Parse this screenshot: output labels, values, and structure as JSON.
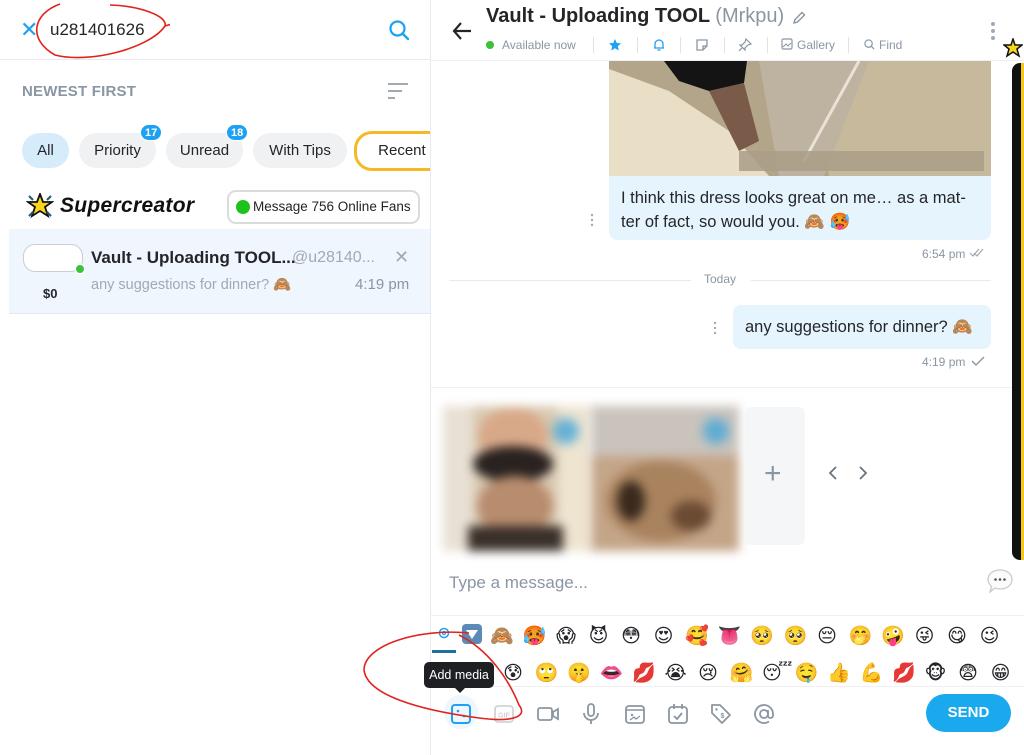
{
  "search": {
    "value": "u281401626",
    "clear_icon": "close-icon",
    "search_icon": "search-icon"
  },
  "sort": {
    "label": "NEWEST FIRST",
    "icon": "sort-icon"
  },
  "filters": [
    {
      "label": "All",
      "active": true
    },
    {
      "label": "Priority",
      "badge": "17"
    },
    {
      "label": "Unread",
      "badge": "18"
    },
    {
      "label": "With Tips"
    },
    {
      "label": "Recent B"
    }
  ],
  "supercreator": {
    "brand": "Supercreator",
    "online_button": "Message 756 Online Fans"
  },
  "chat_list": [
    {
      "name": "Vault - Uploading TOOL...",
      "handle": "@u28140...",
      "preview": "any suggestions for dinner? 🙈",
      "time": "4:19 pm",
      "amount": "$0",
      "online": true
    }
  ],
  "conversation": {
    "title": "Vault - Uploading TOOL",
    "nickname": "(Mrkpu)",
    "status": "Available now",
    "actions": {
      "gallery": "Gallery",
      "find": "Find"
    },
    "messages": [
      {
        "type": "photo",
        "text": "I think this dress looks great on me… as a mat-ter of fact, so would you. 🙈 🥵",
        "time": "6:54 pm",
        "read_status": "double-check"
      },
      {
        "type": "divider",
        "label": "Today"
      },
      {
        "type": "text",
        "text": "any suggestions for dinner? 🙈",
        "time": "4:19 pm",
        "read_status": "single-check"
      }
    ]
  },
  "composer": {
    "placeholder": "Type a message...",
    "attached_media_count": 2,
    "emoji_row_1": [
      "🙈",
      "🥵",
      "😱",
      "😈",
      "😳",
      "😍",
      "🥰",
      "👅",
      "🥺",
      "🥺",
      "😔",
      "🤭",
      "🤪",
      "😜",
      "😋",
      "😉"
    ],
    "emoji_row_2": [
      "😰",
      "🙄",
      "🤫",
      "👄",
      "💋",
      "😭",
      "😢",
      "🤗",
      "😴",
      "🤤",
      "👍",
      "💪",
      "💋",
      "🐵",
      "😨",
      "😁"
    ],
    "tooltip": "Add media",
    "send_label": "SEND",
    "toolbar": [
      "add-media",
      "gif",
      "video",
      "voice",
      "vault",
      "schedule",
      "price-tag",
      "mention"
    ]
  },
  "colors": {
    "accent": "#1ba9ee",
    "online": "#3cc13b",
    "active_tab_bg": "#d6ecfb",
    "outline_tab": "#f5b925",
    "bubble_bg": "#e6f5fd"
  }
}
